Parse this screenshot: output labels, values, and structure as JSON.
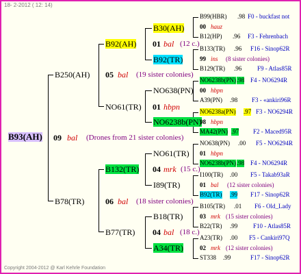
{
  "header": "18-  2-2012 ( 12: 14)",
  "footer": "Copyright 2004-2012 @ Karl Kehrle Foundation",
  "root": {
    "name": "B93(AH)",
    "year": "09",
    "mark": "bal",
    "note": "(Drones from 21 sister colonies)"
  },
  "gen1": {
    "top": {
      "name": "B250(AH)",
      "year": "05",
      "mark": "bal",
      "note": "(19 sister colonies)"
    },
    "bottom": {
      "name": "B78(TR)",
      "year": "06",
      "mark": "bal",
      "note": "(18 sister colonies)"
    }
  },
  "gen2": {
    "a": {
      "name": "B92(AH)",
      "year": "01",
      "mark": "bal",
      "note": "(12 c.)"
    },
    "b": {
      "name": "NO61(TR)",
      "year": "01",
      "mark": "hbpn",
      "note": ""
    },
    "c": {
      "name": "B132(TR)",
      "year": "04",
      "mark": "mrk",
      "note": "(15 c.)"
    },
    "d": {
      "name": "B77(TR)",
      "year": "04",
      "mark": "bal",
      "note": "(18 c.)"
    }
  },
  "gen3": {
    "a1": "B30(AH)",
    "a2": "B92(TR)",
    "b1": "NO638(PN)",
    "b2": "NO6238b(PN)",
    "c1": "NO61(TR)",
    "c2": "I89(TR)",
    "d1": "B18(TR)",
    "d2": "A34(TR)"
  },
  "gen4": [
    {
      "name": "B99(HBR)",
      "score": ".98",
      "code": "F0 - buckfast not"
    },
    {
      "year": "00",
      "mark": "hauz"
    },
    {
      "name": "B12(HP)",
      "score": ".96",
      "code": "F3 - Fehrenbach"
    },
    {
      "name": "B133(TR)",
      "score": ".96",
      "code": "F16 - Sinop62R"
    },
    {
      "year": "99",
      "mark": "ins",
      "note": "(8 sister colonies)"
    },
    {
      "name": "B129(TR)",
      "score": ".96",
      "code": "F9 - Atlas85R"
    },
    {
      "name": "NO6238b(PN)",
      "score": ".98",
      "code": "F4 - NO6294R"
    },
    {
      "year": "00",
      "mark": "hbpn"
    },
    {
      "name": "A39(PN)",
      "score": ".98",
      "code": "F3 - «ankiri96R"
    },
    {
      "name": "NO6238a(PN)",
      "score": ".97",
      "code": "F3 - NO6294R"
    },
    {
      "year": "98",
      "mark": "hbpn"
    },
    {
      "name": "MA42(PN)",
      "score": ".97",
      "code": "F2 - Maced95R"
    },
    {
      "name": "NO638(PN)",
      "score": ".00",
      "code": "F5 - NO6294R"
    },
    {
      "year": "01",
      "mark": "hbpn"
    },
    {
      "name": "NO6238b(PN)",
      "score": ".98",
      "code": "F4 - NO6294R"
    },
    {
      "name": "I100(TR)",
      "score": ".00",
      "code": "F5 - Takab93aR"
    },
    {
      "year": "01",
      "mark": "bal",
      "note": "(12 sister colonies)"
    },
    {
      "name": "B92(TR)",
      "score": ".99",
      "code": "F17 - Sinop62R"
    },
    {
      "name": "B105(TR)",
      "score": ".01",
      "code": "F6 - Old_Lady"
    },
    {
      "year": "03",
      "mark": "mrk",
      "note": "(15 sister colonies)"
    },
    {
      "name": "B22(TR)",
      "score": ".99",
      "code": "F10 - Atlas85R"
    },
    {
      "name": "A23(TR)",
      "score": ".00",
      "code": "F5 - Cankiri97Q"
    },
    {
      "year": "02",
      "mark": "mrk",
      "note": "(12 sister colonies)"
    },
    {
      "name": "ST338",
      "score": ".99",
      "code": "F17 - Sinop62R"
    }
  ]
}
